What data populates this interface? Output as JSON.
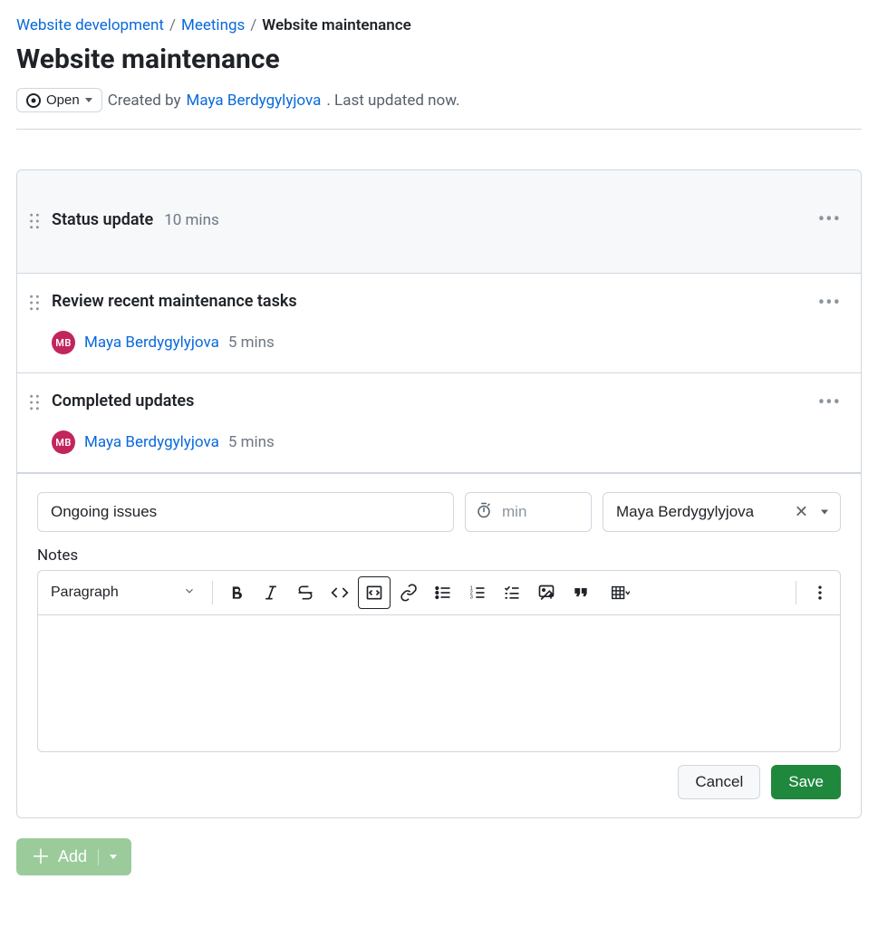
{
  "breadcrumb": {
    "items": [
      {
        "label": "Website development"
      },
      {
        "label": "Meetings"
      }
    ],
    "current": "Website maintenance",
    "sep": "/"
  },
  "page": {
    "title": "Website maintenance"
  },
  "status": {
    "label": "Open"
  },
  "meta": {
    "created_by_prefix": "Created by ",
    "author": "Maya Berdygylyjova",
    "updated_suffix": ". Last updated now."
  },
  "agenda": [
    {
      "title": "Status update",
      "duration": "10 mins",
      "assignee": null
    },
    {
      "title": "Review recent maintenance tasks",
      "duration": "5 mins",
      "assignee": {
        "name": "Maya Berdygylyjova",
        "initials": "MB"
      }
    },
    {
      "title": "Completed updates",
      "duration": "5 mins",
      "assignee": {
        "name": "Maya Berdygylyjova",
        "initials": "MB"
      }
    }
  ],
  "form": {
    "title_value": "Ongoing issues",
    "duration_placeholder": "min",
    "assignee_value": "Maya Berdygylyjova",
    "notes_label": "Notes",
    "paragraph_picker": "Paragraph",
    "cancel": "Cancel",
    "save": "Save"
  },
  "add_button": {
    "label": "Add"
  },
  "colors": {
    "link": "#0969da",
    "primary_button": "#1f883d",
    "avatar_bg": "#c2255c"
  }
}
